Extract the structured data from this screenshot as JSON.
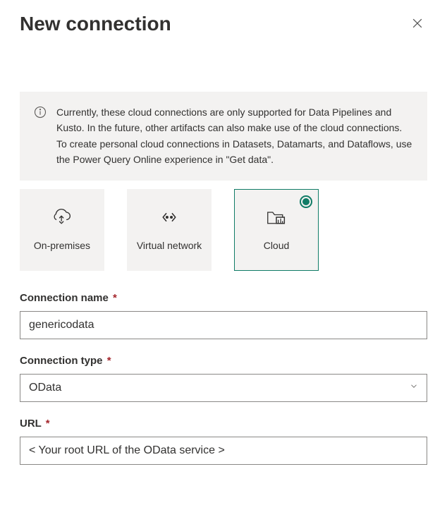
{
  "header": {
    "title": "New connection"
  },
  "info_banner": {
    "text": "Currently, these cloud connections are only supported for Data Pipelines and Kusto. In the future, other artifacts can also make use of the cloud connections. To create personal cloud connections in Datasets, Datamarts, and Dataflows, use the Power Query Online experience in \"Get data\"."
  },
  "connection_types": [
    {
      "label": "On-premises",
      "selected": false
    },
    {
      "label": "Virtual network",
      "selected": false
    },
    {
      "label": "Cloud",
      "selected": true
    }
  ],
  "form": {
    "connection_name": {
      "label": "Connection name",
      "required_mark": "*",
      "value": "genericodata"
    },
    "connection_type": {
      "label": "Connection type",
      "required_mark": "*",
      "value": "OData"
    },
    "url": {
      "label": "URL",
      "required_mark": "*",
      "placeholder": "< Your root URL of the OData service >",
      "value": ""
    }
  }
}
